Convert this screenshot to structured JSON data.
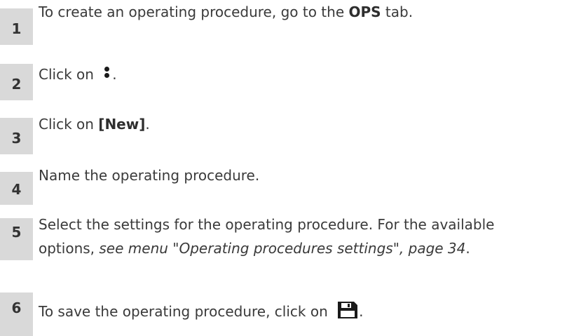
{
  "steps": [
    {
      "number": "1",
      "text_before": "To create an operating procedure, go to the ",
      "bold": "OPS",
      "text_after": " tab."
    },
    {
      "number": "2",
      "text_before": "Click on ",
      "icon": "more-vertical-icon",
      "text_after": "."
    },
    {
      "number": "3",
      "text_before": "Click on ",
      "bold": "[New]",
      "text_after": "."
    },
    {
      "number": "4",
      "text": "Name the operating procedure."
    },
    {
      "number": "5",
      "line1": "Select the settings for the operating procedure. For the available",
      "line2_before": "options, ",
      "line2_italic": "see menu \"Operating procedures settings\", page 34",
      "line2_after": "."
    },
    {
      "number": "6",
      "text_before": "To save the operating procedure, click on ",
      "icon": "save-icon",
      "text_after": "."
    }
  ]
}
